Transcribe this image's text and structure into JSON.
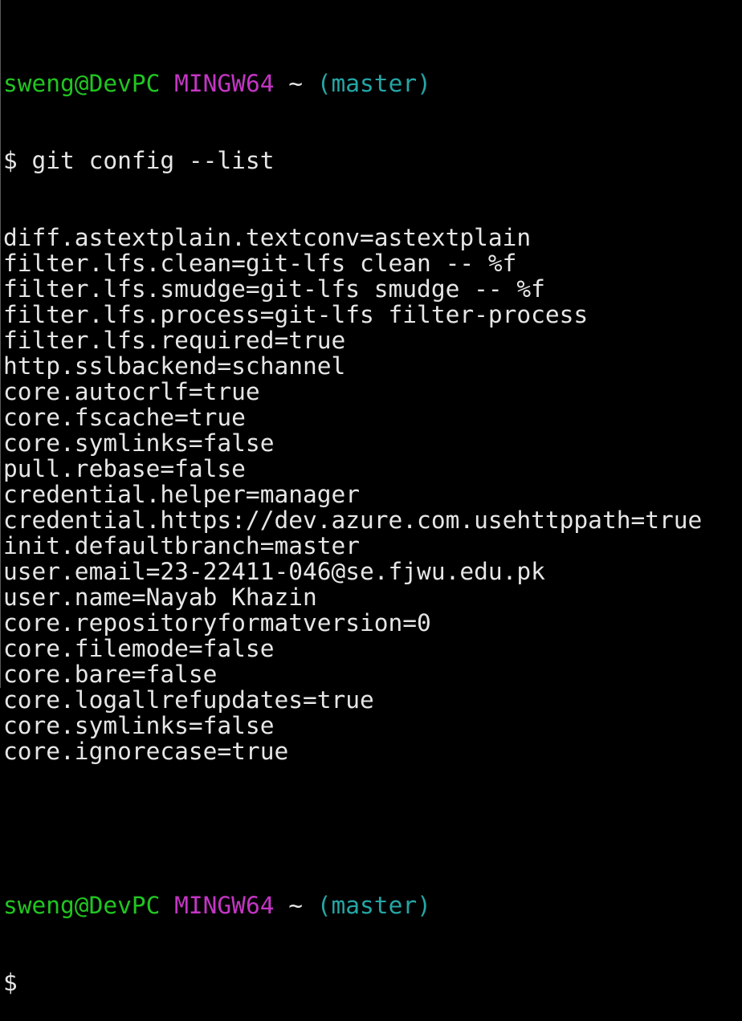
{
  "prompt1": {
    "user_host": "sweng@DevPC",
    "system": "MINGW64",
    "path": "~",
    "branch": "(master)"
  },
  "command_line": "$ git config --list",
  "output_lines": [
    "diff.astextplain.textconv=astextplain",
    "filter.lfs.clean=git-lfs clean -- %f",
    "filter.lfs.smudge=git-lfs smudge -- %f",
    "filter.lfs.process=git-lfs filter-process",
    "filter.lfs.required=true",
    "http.sslbackend=schannel",
    "core.autocrlf=true",
    "core.fscache=true",
    "core.symlinks=false",
    "pull.rebase=false",
    "credential.helper=manager",
    "credential.https://dev.azure.com.usehttppath=true",
    "init.defaultbranch=master",
    "user.email=23-22411-046@se.fjwu.edu.pk",
    "user.name=Nayab Khazin",
    "core.repositoryformatversion=0",
    "core.filemode=false",
    "core.bare=false",
    "core.logallrefupdates=true",
    "core.symlinks=false",
    "core.ignorecase=true"
  ],
  "prompt2": {
    "user_host": "sweng@DevPC",
    "system": "MINGW64",
    "path": "~",
    "branch": "(master)"
  },
  "cursor_prompt": "$",
  "colors": {
    "background": "#000000",
    "text": "#e6e6e6",
    "user_host": "#21c521",
    "system": "#c436c4",
    "branch": "#25a6a6"
  }
}
